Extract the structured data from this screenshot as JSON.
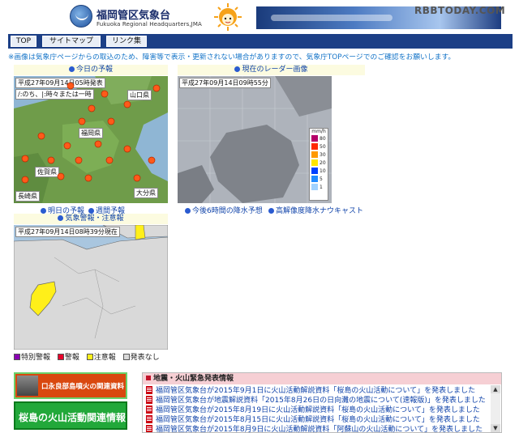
{
  "header": {
    "office_name": "福岡管区気象台",
    "office_name_en": "Fukuoka Regional Headquarters,JMA",
    "watermark": "RBBTODAY.COM"
  },
  "nav": [
    "TOP",
    "サイトマップ",
    "リンク集"
  ],
  "notice": "※画像は気象庁ページからの取込のため、障害等で表示・更新されない場合がありますので、気象庁TOPページでのご確認をお願いします。",
  "forecast": {
    "title": "今日の予報",
    "timestamp": "平成27年09月14日05時発表",
    "legend_text": "/:のち、|:時々または一時",
    "places": {
      "yamaguchi": "山口県",
      "fukuoka": "福岡県",
      "saga": "佐賀県",
      "nagasaki": "長崎県",
      "oita": "大分県"
    },
    "links": [
      "明日の予報",
      "週間予報"
    ]
  },
  "radar": {
    "title": "現在のレーダー画像",
    "timestamp": "平成27年09月14日09時55分",
    "scale_unit": "mm/h",
    "scale_labels": [
      "80",
      "50",
      "30",
      "20",
      "10",
      "5",
      "1"
    ],
    "scale_colors": [
      "#b40068",
      "#ff2800",
      "#ff9900",
      "#ffe600",
      "#0041ff",
      "#218cff",
      "#a0d2ff"
    ],
    "links": [
      "今後6時間の降水予想",
      "高解像度降水ナウキャスト"
    ]
  },
  "warnings": {
    "title": "気象警報・注意報",
    "timestamp": "平成27年09月14日08時39分現在",
    "legend": [
      {
        "label": "特別警報",
        "color": "#8b00b4"
      },
      {
        "label": "警報",
        "color": "#e8002a"
      },
      {
        "label": "注意報",
        "color": "#ffef1a"
      },
      {
        "label": "発表なし",
        "color": "#d9d9d9"
      }
    ]
  },
  "banners": {
    "volcano_kuchinoerabu": "口永良部島噴火の関連資料",
    "sakurajima": "桜島の火山活動関連情報"
  },
  "news": {
    "title": "地震・火山緊急発表情報",
    "items": [
      "福岡管区気象台が2015年9月1日に火山活動解説資料「桜島の火山活動について」を発表しました",
      "福岡管区気象台が地震解説資料「2015年8月26日の日向灘の地震について(速報版)」を発表しました",
      "福岡管区気象台が2015年8月19日に火山活動解説資料「桜島の火山活動について」を発表しました",
      "福岡管区気象台が2015年8月15日に火山活動解説資料「桜島の火山活動について」を発表しました",
      "福岡管区気象台が2015年8月9日に火山活動解説資料「阿蘇山の火山活動について」を発表しました"
    ]
  },
  "colors": {
    "nav_bg": "#1c3f86",
    "link": "#1144aa",
    "notice": "#1474c8",
    "warning_yellow": "#ffef1a"
  }
}
